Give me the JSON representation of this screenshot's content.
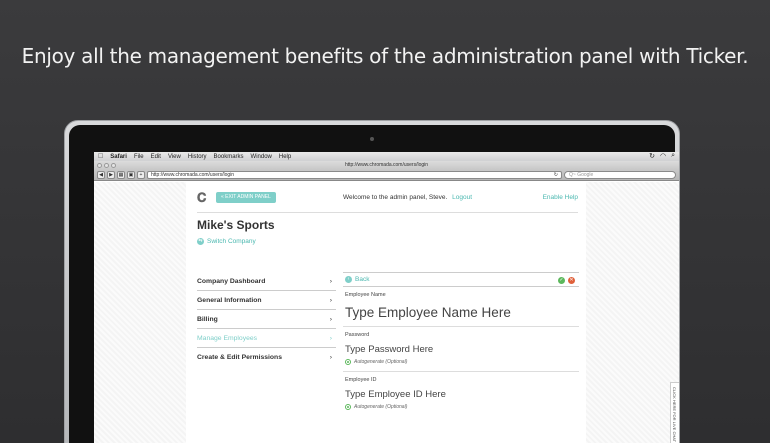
{
  "headline": "Enjoy all the management benefits of the administration panel with Ticker.",
  "menubar": {
    "apple": "",
    "app": "Safari",
    "items": [
      "File",
      "Edit",
      "View",
      "History",
      "Bookmarks",
      "Window",
      "Help"
    ]
  },
  "browser": {
    "title": "http://www.chromada.com/users/login",
    "url": "http://www.chromada.com/users/login",
    "search_placeholder": "Q~ Google"
  },
  "admin": {
    "exit_label": "« EXIT ADMIN PANEL",
    "welcome": "Welcome to the admin panel, Steve.",
    "logout": "Logout",
    "help": "Enable Help",
    "company": "Mike's Sports",
    "switch": "Switch Company",
    "nav": [
      {
        "label": "Company Dashboard"
      },
      {
        "label": "General Information"
      },
      {
        "label": "Billing"
      },
      {
        "label": "Manage Employees"
      },
      {
        "label": "Create & Edit Permissions"
      }
    ],
    "back": "Back",
    "fields": {
      "name_label": "Employee Name",
      "name_value": "Type Employee Name Here",
      "password_label": "Password",
      "password_value": "Type Password Here",
      "password_auto": "Autogenerate (Optional)",
      "id_label": "Employee ID",
      "id_value": "Type Employee ID Here",
      "id_auto": "Autogenerate (Optional)"
    },
    "side_tab": "CLICK HERE FOR LIVE CHAT"
  }
}
